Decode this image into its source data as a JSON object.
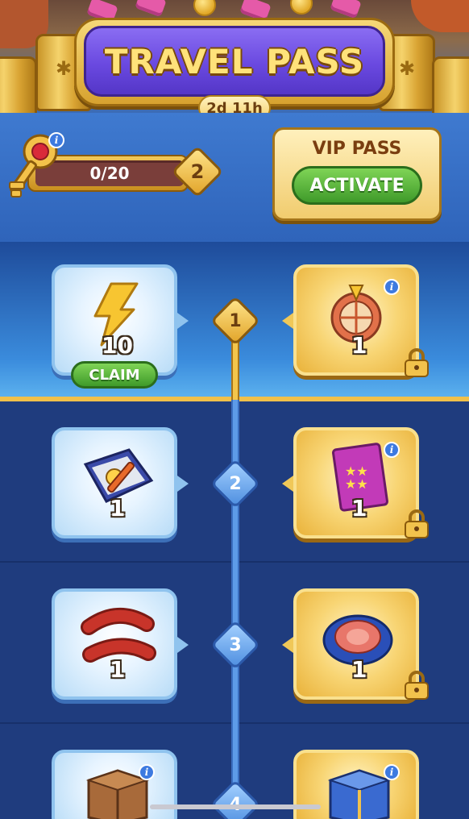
{
  "header": {
    "title": "TRAVEL PASS",
    "timer": "2d 11h"
  },
  "progress": {
    "keys_text": "0/20",
    "keys_current": 0,
    "keys_max": 20,
    "level": "2"
  },
  "vip": {
    "title": "VIP PASS",
    "button_label": "ACTIVATE"
  },
  "rows": [
    {
      "step": "1",
      "free": {
        "icon": "lightning-bolt-icon",
        "qty": "10",
        "claim_label": "CLAIM"
      },
      "vip": {
        "icon": "spin-wheel-icon",
        "qty": "1",
        "locked": true
      }
    },
    {
      "step": "2",
      "free": {
        "icon": "toolbox-icon",
        "qty": "1"
      },
      "vip": {
        "icon": "sticker-pack-icon",
        "qty": "1",
        "locked": true
      }
    },
    {
      "step": "3",
      "free": {
        "icon": "sausage-icon",
        "qty": "1"
      },
      "vip": {
        "icon": "sea-urchin-icon",
        "qty": "1",
        "locked": true
      }
    },
    {
      "step": "4",
      "free": {
        "icon": "wooden-crate-icon"
      },
      "vip": {
        "icon": "blue-crate-icon"
      }
    }
  ],
  "colors": {
    "title_banner": "#6a49e0",
    "title_text": "#ffe27a",
    "button_green": "#3f9a2a",
    "free_card": "#e7f4ff",
    "vip_card": "#f8d574",
    "background": "#1f3c7e"
  }
}
